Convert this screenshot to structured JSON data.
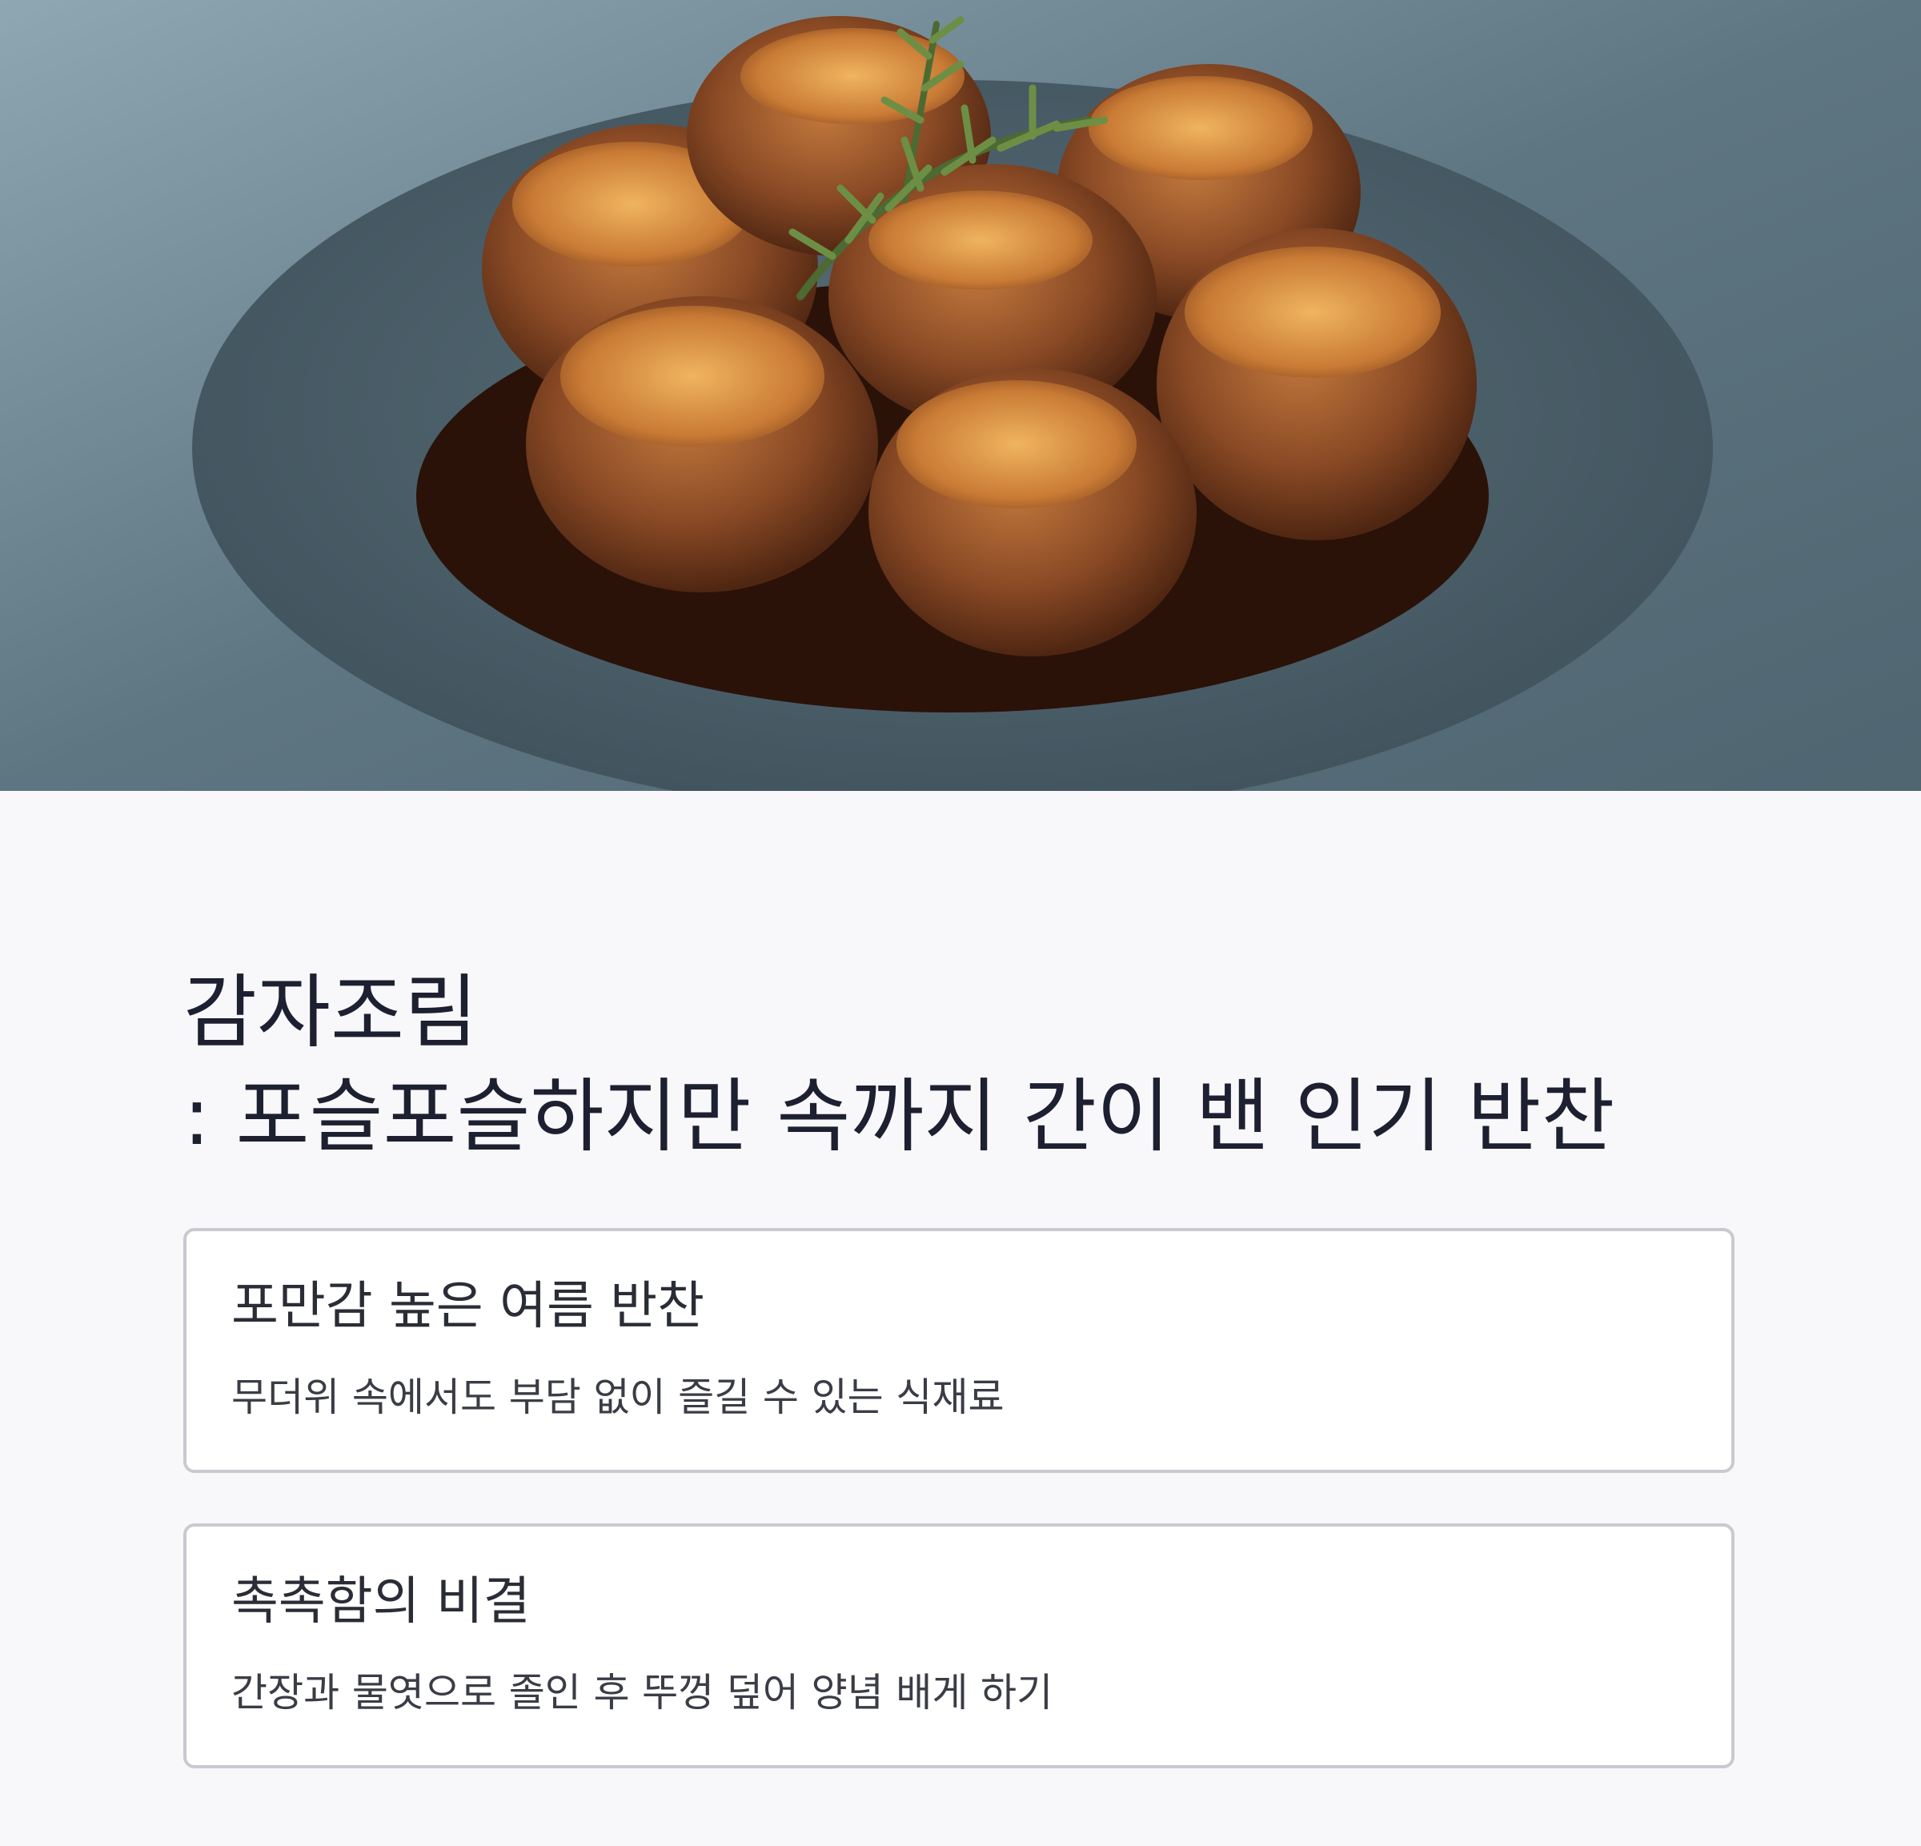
{
  "hero": {
    "image_name": "braised-potatoes-photo"
  },
  "title": {
    "line1": "감자조림",
    "line2": ": 포슬포슬하지만 속까지 간이 밴 인기 반찬"
  },
  "cards": [
    {
      "heading": "포만감 높은 여름 반찬",
      "text": "무더위 속에서도 부담 없이 즐길 수 있는 식재료"
    },
    {
      "heading": "촉촉함의 비결",
      "text": "간장과 물엿으로 졸인 후 뚜껑 덮어 양념 배게 하기"
    }
  ]
}
